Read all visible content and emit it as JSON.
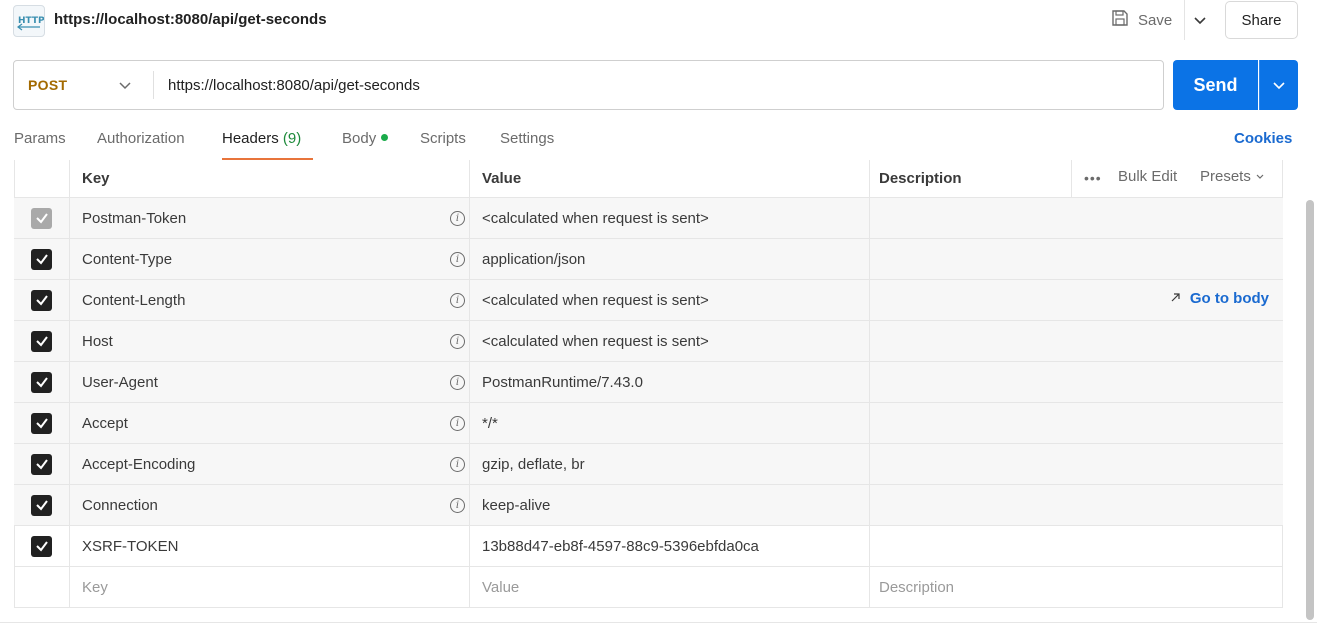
{
  "request": {
    "title": "https://localhost:8080/api/get-seconds",
    "icon": "http-request-icon",
    "method": "POST",
    "url": "https://localhost:8080/api/get-seconds"
  },
  "toolbar": {
    "save_label": "Save",
    "share_label": "Share",
    "send_label": "Send"
  },
  "tabs": [
    {
      "label": "Params"
    },
    {
      "label": "Authorization"
    },
    {
      "label": "Headers",
      "count": "(9)"
    },
    {
      "label": "Body"
    },
    {
      "label": "Scripts"
    },
    {
      "label": "Settings"
    }
  ],
  "cookies_label": "Cookies",
  "headers_table": {
    "columns": {
      "key": "Key",
      "value": "Value",
      "description": "Description"
    },
    "bulk_edit": "Bulk Edit",
    "presets": "Presets",
    "rows": [
      {
        "key": "Postman-Token",
        "value": "<calculated when request is sent>",
        "checked": true,
        "disabled": true
      },
      {
        "key": "Content-Type",
        "value": "application/json",
        "checked": true
      },
      {
        "key": "Content-Length",
        "value": "<calculated when request is sent>",
        "checked": true,
        "action": "Go to body"
      },
      {
        "key": "Host",
        "value": "<calculated when request is sent>",
        "checked": true
      },
      {
        "key": "User-Agent",
        "value": "PostmanRuntime/7.43.0",
        "checked": true
      },
      {
        "key": "Accept",
        "value": "*/*",
        "checked": true
      },
      {
        "key": "Accept-Encoding",
        "value": "gzip, deflate, br",
        "checked": true
      },
      {
        "key": "Connection",
        "value": "keep-alive",
        "checked": true
      },
      {
        "key": "XSRF-TOKEN",
        "value": "13b88d47-eb8f-4597-88c9-5396ebfda0ca",
        "checked": true
      }
    ],
    "placeholders": {
      "key": "Key",
      "value": "Value",
      "description": "Description"
    }
  },
  "colors": {
    "accent": "#0b73e6",
    "method": "#a36a00",
    "tab_underline": "#e8743b",
    "link": "#1a6ad0",
    "count": "#1d8a3a"
  }
}
